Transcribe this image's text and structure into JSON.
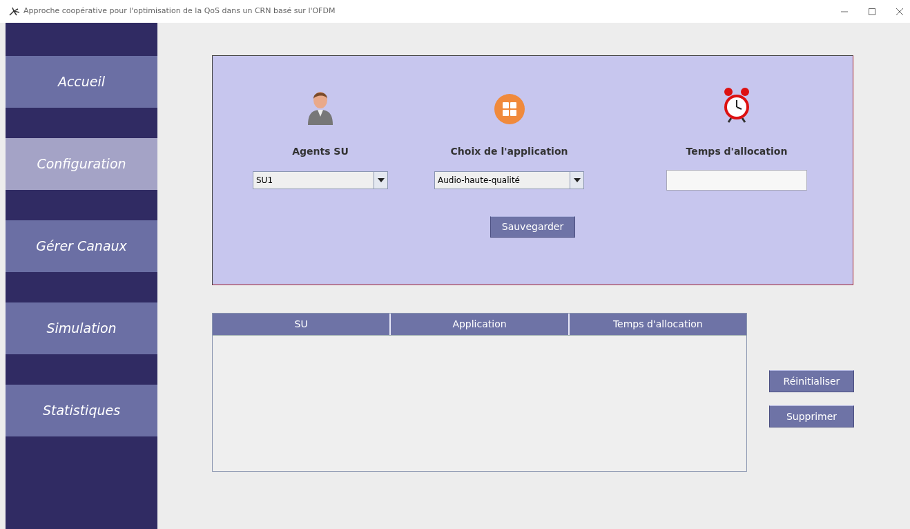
{
  "window": {
    "title": "Approche coopérative pour l'optimisation de la QoS dans un CRN basé sur l'OFDM"
  },
  "sidebar": {
    "items": [
      {
        "label": "Accueil",
        "selected": false
      },
      {
        "label": "Configuration",
        "selected": true
      },
      {
        "label": "Gérer Canaux",
        "selected": false
      },
      {
        "label": "Simulation",
        "selected": false
      },
      {
        "label": "Statistiques",
        "selected": false
      }
    ]
  },
  "form": {
    "fields": [
      {
        "kind": "combo",
        "label": "Agents SU",
        "value": "SU1"
      },
      {
        "kind": "combo",
        "label": "Choix de l'application",
        "value": "Audio-haute-qualité"
      },
      {
        "kind": "text",
        "label": "Temps d'allocation"
      }
    ],
    "save_button": "Sauvegarder"
  },
  "table": {
    "columns": [
      "SU",
      "Application",
      "Temps d'allocation"
    ]
  },
  "actions": [
    "Réinitialiser",
    "Supprimer"
  ]
}
